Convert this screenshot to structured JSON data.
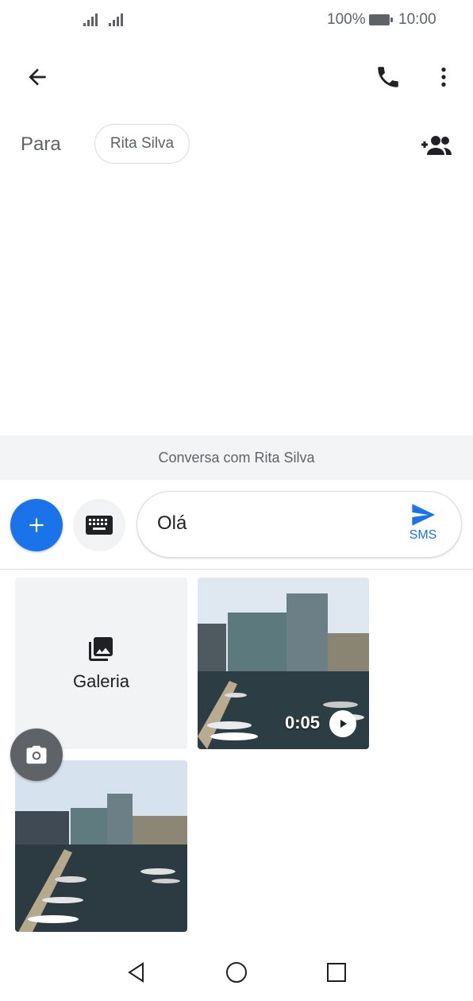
{
  "status_bar": {
    "battery_percent": "100%",
    "time": "10:00",
    "signal_icons": [
      "signal-bars-icon",
      "signal-bars-icon"
    ],
    "battery_icon": "battery-icon"
  },
  "app_bar": {
    "back_icon": "arrow-left-icon",
    "call_icon": "phone-icon",
    "menu_icon": "more-vert-icon"
  },
  "recipient": {
    "label": "Para",
    "chip": "Rita Silva",
    "add_icon": "add-people-icon"
  },
  "conversation": {
    "banner": "Conversa com Rita Silva"
  },
  "compose": {
    "add_icon": "plus-icon",
    "keyboard_icon": "keyboard-icon",
    "message": "Olá",
    "send_icon": "send-icon",
    "send_label": "SMS"
  },
  "media_picker": {
    "gallery_label": "Galeria",
    "gallery_icon": "photo-library-icon",
    "camera_icon": "camera-icon",
    "video_duration": "0:05",
    "play_icon": "play-icon"
  },
  "colors": {
    "accent": "#1a73e8",
    "banner_bg": "#f3f4f6",
    "icon_dark": "#202124"
  },
  "nav_bar": {
    "back_icon": "triangle-back-icon",
    "home_icon": "circle-home-icon",
    "recents_icon": "square-recents-icon"
  }
}
